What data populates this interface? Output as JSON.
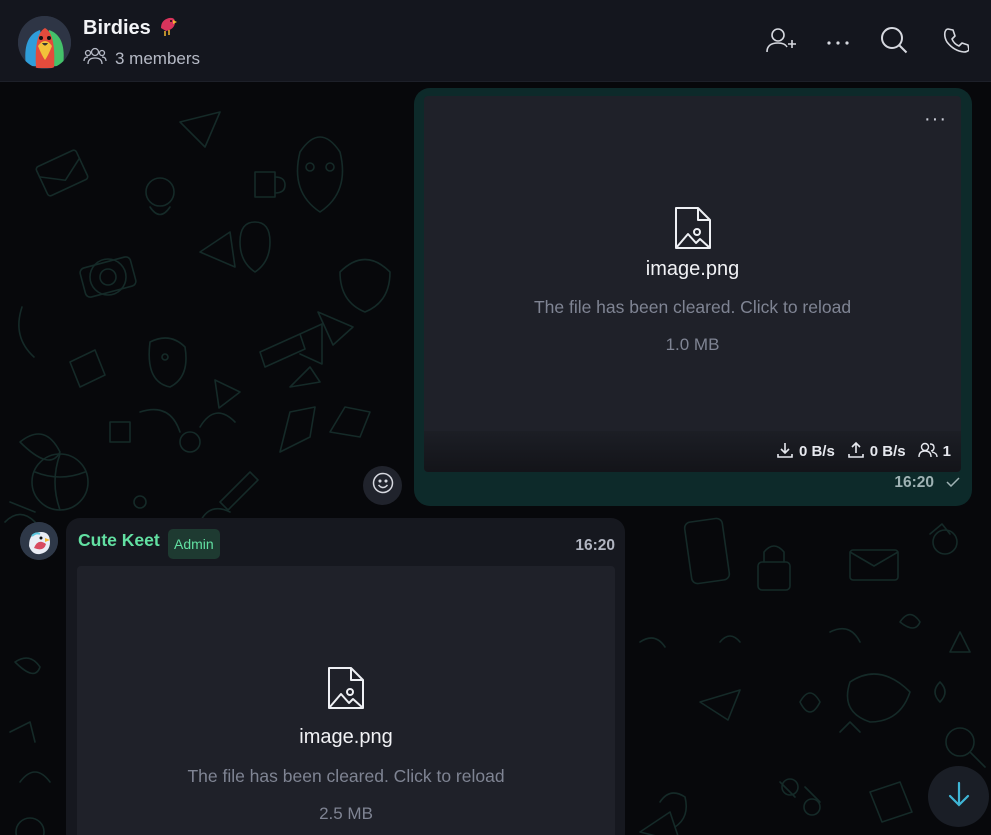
{
  "header": {
    "title": "Birdies",
    "title_emoji": "bird-emoji",
    "members": "3 members",
    "actions": [
      "add-member-icon",
      "more-icon",
      "search-icon",
      "phone-icon"
    ]
  },
  "outgoing": {
    "file_name": "image.png",
    "hint": "The file has been cleared. Click to reload",
    "size": "1.0 MB",
    "download_speed": "0 B/s",
    "upload_speed": "0 B/s",
    "peers": "1",
    "time": "16:20",
    "menu": "···"
  },
  "incoming": {
    "sender": "Cute Keet",
    "badge": "Admin",
    "time": "16:20",
    "file_name": "image.png",
    "hint": "The file has been cleared. Click to reload",
    "size": "2.5 MB"
  },
  "colors": {
    "accent_green": "#62e0a2",
    "outgoing_bubble": "#0d2a2a",
    "scroll_arrow": "#3fb6d6"
  }
}
